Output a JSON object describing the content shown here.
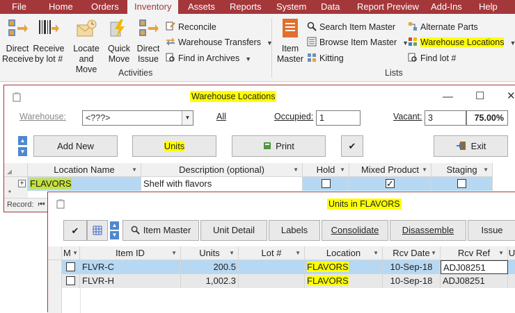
{
  "ribbon": {
    "tabs": [
      "File",
      "Home",
      "Orders",
      "Inventory",
      "Assets",
      "Reports",
      "System",
      "Data",
      "Report Preview",
      "Add-Ins",
      "Help"
    ],
    "active_tab": "Inventory",
    "activities": {
      "group_label": "Activities",
      "buttons": [
        {
          "line1": "Direct",
          "line2": "Receive"
        },
        {
          "line1": "Receive",
          "line2": "by lot #"
        },
        {
          "line1": "Locate",
          "line2": "and Move"
        },
        {
          "line1": "Quick",
          "line2": "Move"
        },
        {
          "line1": "Direct",
          "line2": "Issue"
        }
      ],
      "small": [
        "Reconcile",
        "Warehouse Transfers",
        "Find in Archives"
      ]
    },
    "lists": {
      "group_label": "Lists",
      "item_master": {
        "line1": "Item",
        "line2": "Master"
      },
      "small": [
        "Search Item Master",
        "Browse Item Master",
        "Kitting",
        "Alternate Parts",
        "Warehouse Locations",
        "Find lot #"
      ]
    }
  },
  "warehouse_form": {
    "title": "Warehouse Locations",
    "warehouse_label": "Warehouse:",
    "warehouse_value": "<???>",
    "all_link": "All",
    "occupied_label": "Occupied:",
    "occupied_value": "1",
    "vacant_label": "Vacant:",
    "vacant_value": "3",
    "vacant_percent": "75.00%",
    "buttons": {
      "add_new": "Add New",
      "units": "Units",
      "print": "Print",
      "exit": "Exit"
    },
    "columns": [
      "Location Name",
      "Description (optional)",
      "Hold",
      "Mixed Product",
      "Staging"
    ],
    "row": {
      "expander": "+",
      "location": "FLAVORS",
      "description": "Shelf with flavors",
      "hold": false,
      "mixed": true,
      "staging": false
    },
    "record_label": "Record:"
  },
  "units_form": {
    "title": "Units in FLAVORS",
    "buttons": {
      "item_master": "Item Master",
      "unit_detail": "Unit Detail",
      "labels": "Labels",
      "consolidate": "Consolidate",
      "disassemble": "Disassemble",
      "issue": "Issue"
    },
    "columns": [
      "M",
      "Item ID",
      "Units",
      "Lot #",
      "Location",
      "Rcv Date",
      "Rcv Ref",
      "U"
    ],
    "rows": [
      {
        "item_id": "FLVR-C",
        "units": "200.5",
        "lot": "",
        "location": "FLAVORS",
        "rcv_date": "10-Sep-18",
        "rcv_ref": "ADJ08251"
      },
      {
        "item_id": "FLVR-H",
        "units": "1,002.3",
        "lot": "",
        "location": "FLAVORS",
        "rcv_date": "10-Sep-18",
        "rcv_ref": "ADJ08251"
      }
    ]
  },
  "colors": {
    "accent": "#a4373a",
    "highlight": "#ffff00",
    "row_selected": "#b7d8f2"
  }
}
